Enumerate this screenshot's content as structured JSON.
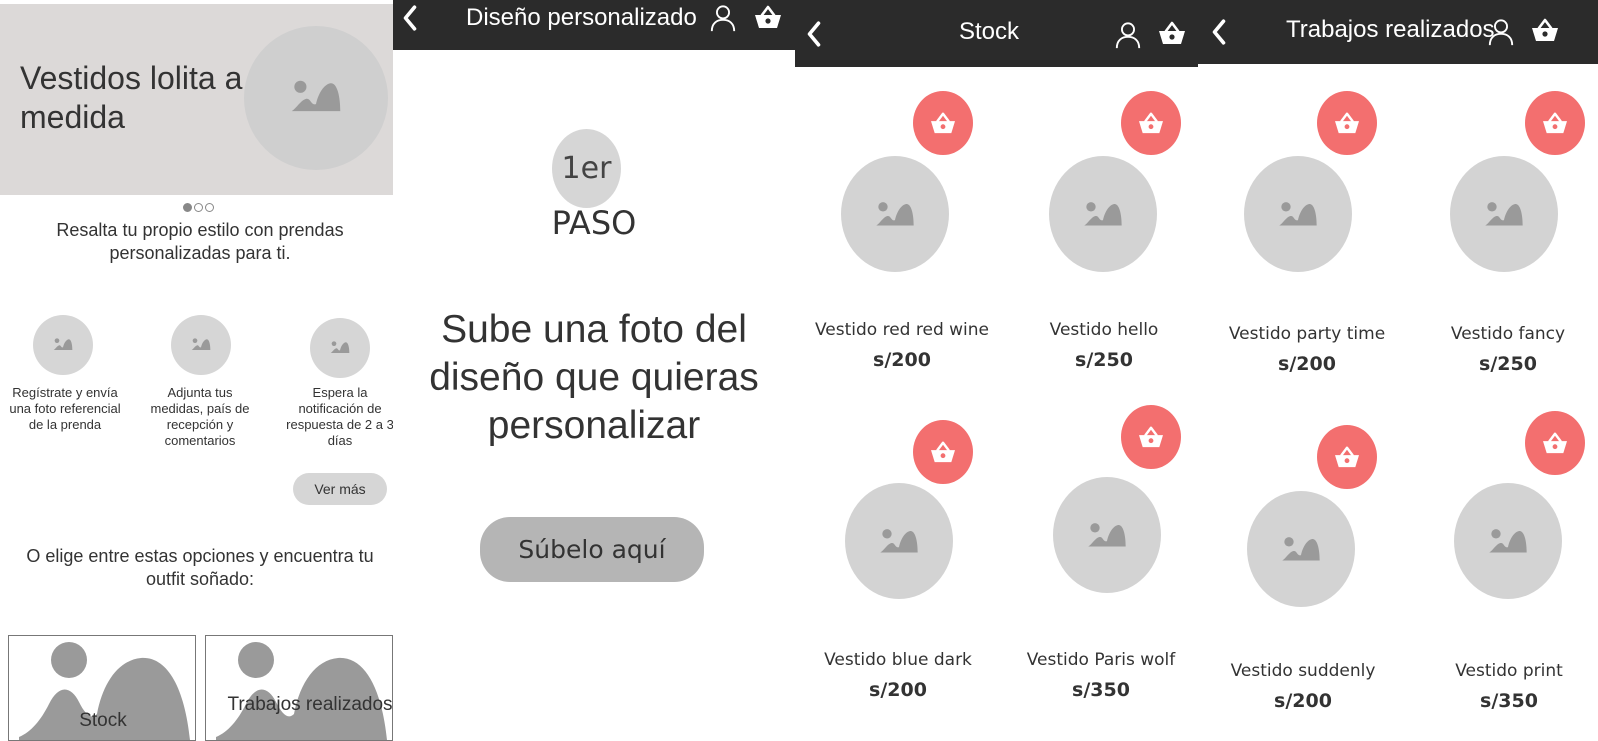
{
  "home": {
    "hero_title": "Vestidos lolita a medida",
    "carousel_dots": 3,
    "carousel_active": 1,
    "tagline": "Resalta tu propio estilo con prendas personalizadas para ti.",
    "steps": [
      {
        "text": "Regístrate y envía una foto referencial de la prenda"
      },
      {
        "text": "Adjunta tus medidas, país de recepción   y comentarios"
      },
      {
        "text": "Espera la notificación de respuesta de 2 a 3 días"
      }
    ],
    "ver_mas": "Ver más",
    "choose_text": "O elige entre estas opciones y encuentra tu outfit soñado:",
    "cards": [
      {
        "label": "Stock"
      },
      {
        "label": "Trabajos realizados"
      }
    ]
  },
  "custom": {
    "title": "Diseño personalizado",
    "step_number": "1er",
    "step_word": "PASO",
    "instruction": "Sube una foto del diseño que quieras personalizar",
    "upload_button": "Súbelo aquí"
  },
  "stock": {
    "title": "Stock",
    "products": [
      {
        "name": "Vestido red red wine",
        "price": "s/200"
      },
      {
        "name": "Vestido hello",
        "price": "s/250"
      },
      {
        "name": "Vestido blue dark",
        "price": "s/200"
      },
      {
        "name": "Vestido Paris wolf",
        "price": "s/350"
      }
    ]
  },
  "works": {
    "title": "Trabajos realizados",
    "products": [
      {
        "name": "Vestido party time",
        "price": "s/200"
      },
      {
        "name": "Vestido fancy",
        "price": "s/250"
      },
      {
        "name": "Vestido suddenly",
        "price": "s/200"
      },
      {
        "name": "Vestido print",
        "price": "s/350"
      }
    ]
  },
  "colors": {
    "topbar": "#2b2b2b",
    "hero_bg": "#dcd9d8",
    "cart_badge": "#f36f6f",
    "placeholder": "#d3d3d3",
    "icon": "#9a9a9a"
  },
  "icons": {
    "back": "chevron-left-icon",
    "user": "user-icon",
    "cart": "basket-icon",
    "image": "image-placeholder-icon"
  }
}
